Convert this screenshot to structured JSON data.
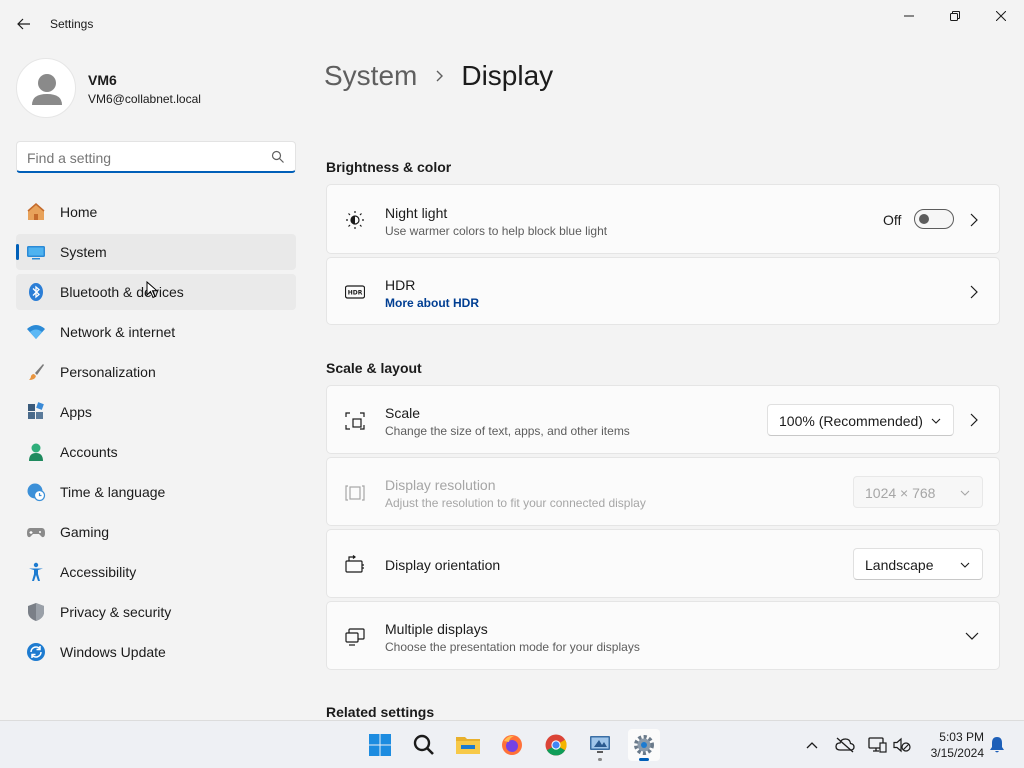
{
  "window": {
    "title": "Settings"
  },
  "profile": {
    "name": "VM6",
    "email": "VM6@collabnet.local"
  },
  "search": {
    "placeholder": "Find a setting"
  },
  "nav": {
    "items": [
      {
        "label": "Home",
        "icon": "home-icon"
      },
      {
        "label": "System",
        "icon": "system-icon",
        "selected": true
      },
      {
        "label": "Bluetooth & devices",
        "icon": "bluetooth-icon"
      },
      {
        "label": "Network & internet",
        "icon": "wifi-icon"
      },
      {
        "label": "Personalization",
        "icon": "brush-icon"
      },
      {
        "label": "Apps",
        "icon": "apps-icon"
      },
      {
        "label": "Accounts",
        "icon": "person-icon"
      },
      {
        "label": "Time & language",
        "icon": "globe-clock-icon"
      },
      {
        "label": "Gaming",
        "icon": "gamepad-icon"
      },
      {
        "label": "Accessibility",
        "icon": "accessibility-icon"
      },
      {
        "label": "Privacy & security",
        "icon": "shield-icon"
      },
      {
        "label": "Windows Update",
        "icon": "update-icon"
      }
    ]
  },
  "breadcrumb": {
    "parent": "System",
    "current": "Display"
  },
  "sections": {
    "brightness": "Brightness & color",
    "scale_layout": "Scale & layout",
    "related": "Related settings"
  },
  "cards": {
    "night_light": {
      "title": "Night light",
      "desc": "Use warmer colors to help block blue light",
      "state": "Off"
    },
    "hdr": {
      "title": "HDR",
      "link": "More about HDR"
    },
    "scale": {
      "title": "Scale",
      "desc": "Change the size of text, apps, and other items",
      "value": "100% (Recommended)"
    },
    "resolution": {
      "title": "Display resolution",
      "desc": "Adjust the resolution to fit your connected display",
      "value": "1024 × 768"
    },
    "orientation": {
      "title": "Display orientation",
      "value": "Landscape"
    },
    "multiple": {
      "title": "Multiple displays",
      "desc": "Choose the presentation mode for your displays"
    }
  },
  "taskbar": {
    "time": "5:03 PM",
    "date": "3/15/2024"
  },
  "colors": {
    "accent": "#005fb8",
    "link": "#003e92",
    "background": "#f3f3f3",
    "card": "#fbfbfb"
  }
}
